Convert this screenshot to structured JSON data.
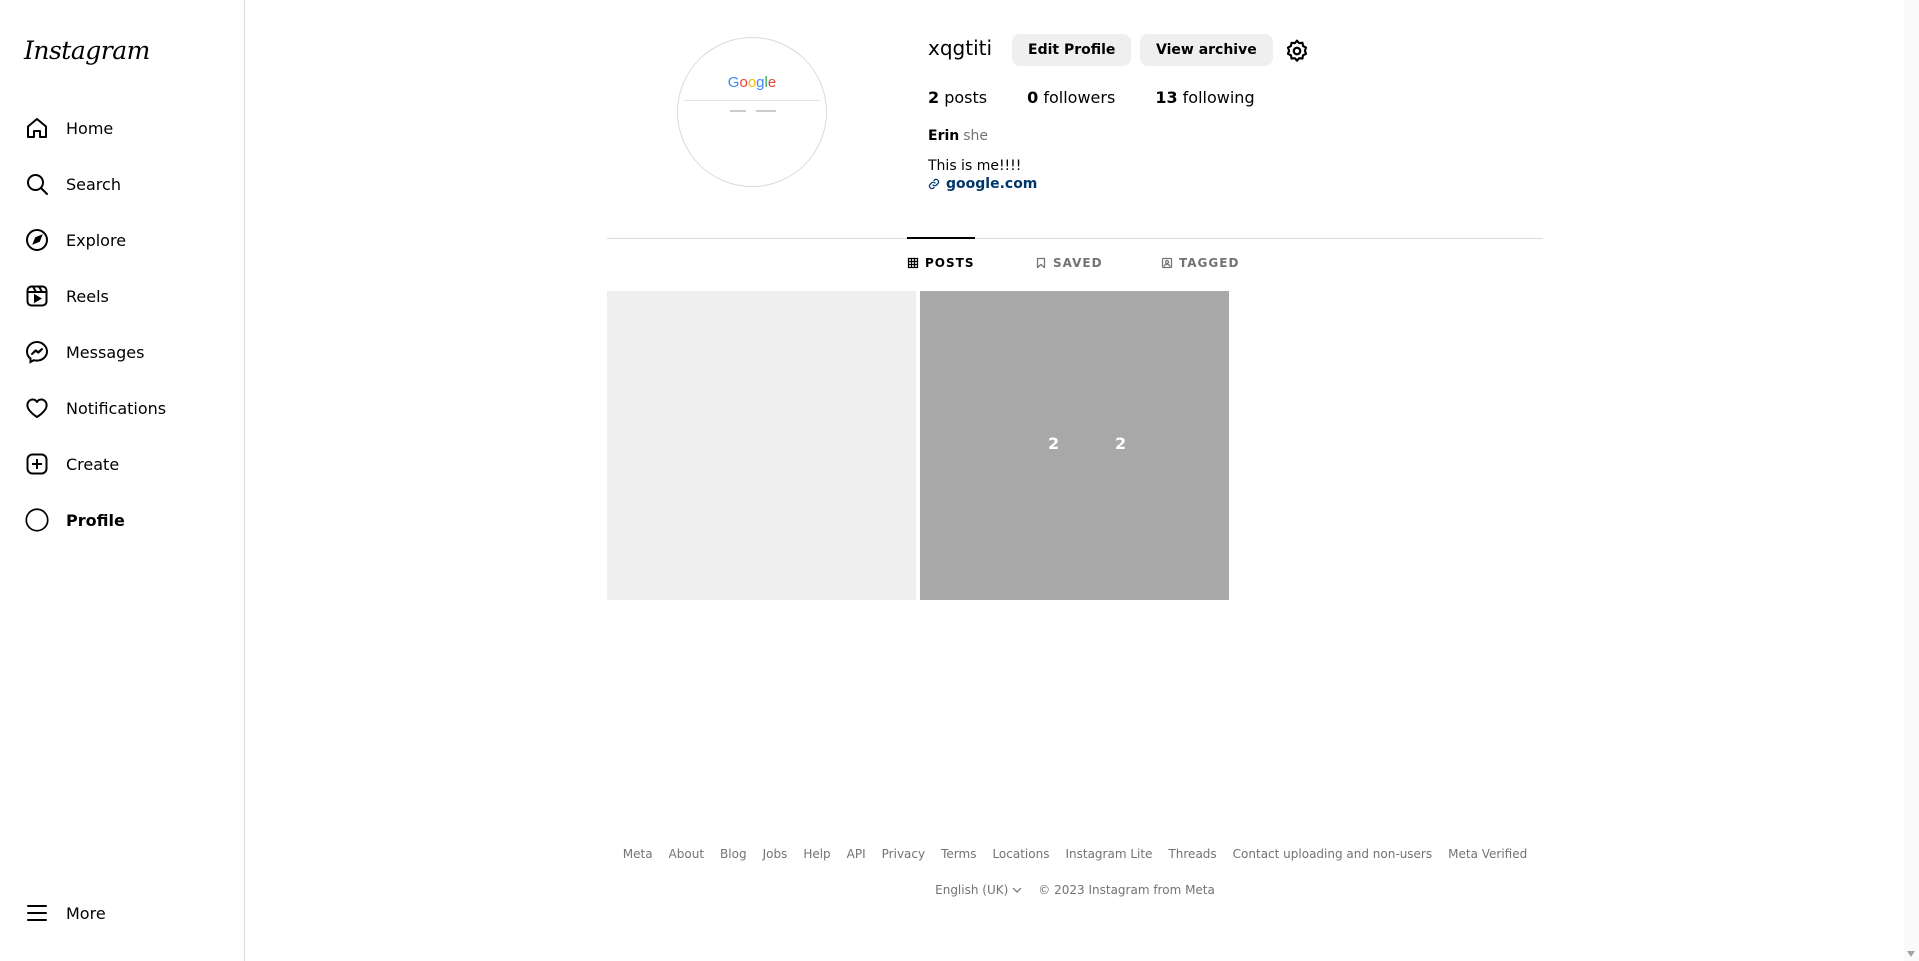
{
  "app": {
    "logo_text": "Instagram"
  },
  "sidebar": {
    "items": [
      {
        "label": "Home",
        "icon": "home-icon"
      },
      {
        "label": "Search",
        "icon": "search-icon"
      },
      {
        "label": "Explore",
        "icon": "compass-icon"
      },
      {
        "label": "Reels",
        "icon": "reels-icon"
      },
      {
        "label": "Messages",
        "icon": "messenger-icon"
      },
      {
        "label": "Notifications",
        "icon": "heart-icon"
      },
      {
        "label": "Create",
        "icon": "plus-square-icon"
      },
      {
        "label": "Profile",
        "icon": "avatar-icon"
      }
    ],
    "more_label": "More"
  },
  "profile": {
    "username": "xqgtiti",
    "edit_label": "Edit Profile",
    "archive_label": "View archive",
    "posts_count": "2",
    "posts_label": "posts",
    "followers_count": "0",
    "followers_label": "followers",
    "following_count": "13",
    "following_label": "following",
    "full_name": "Erin",
    "pronouns": "she",
    "bio": "This is me!!!!",
    "link": "google.com",
    "avatar_text": "Google"
  },
  "tabs": [
    {
      "label": "POSTS",
      "icon": "grid-icon",
      "active": true
    },
    {
      "label": "SAVED",
      "icon": "bookmark-icon",
      "active": false
    },
    {
      "label": "TAGGED",
      "icon": "tagged-icon",
      "active": false
    }
  ],
  "posts": [
    {
      "type": "empty"
    },
    {
      "likes": "2",
      "comments": "2"
    }
  ],
  "footer": {
    "links": [
      "Meta",
      "About",
      "Blog",
      "Jobs",
      "Help",
      "API",
      "Privacy",
      "Terms",
      "Locations",
      "Instagram Lite",
      "Threads",
      "Contact uploading and non-users",
      "Meta Verified"
    ],
    "language": "English (UK)",
    "copyright": "© 2023 Instagram from Meta"
  },
  "colors": {
    "link": "#00376b",
    "muted": "#737373",
    "button_bg": "#efefef",
    "border": "#dbdbdb"
  }
}
